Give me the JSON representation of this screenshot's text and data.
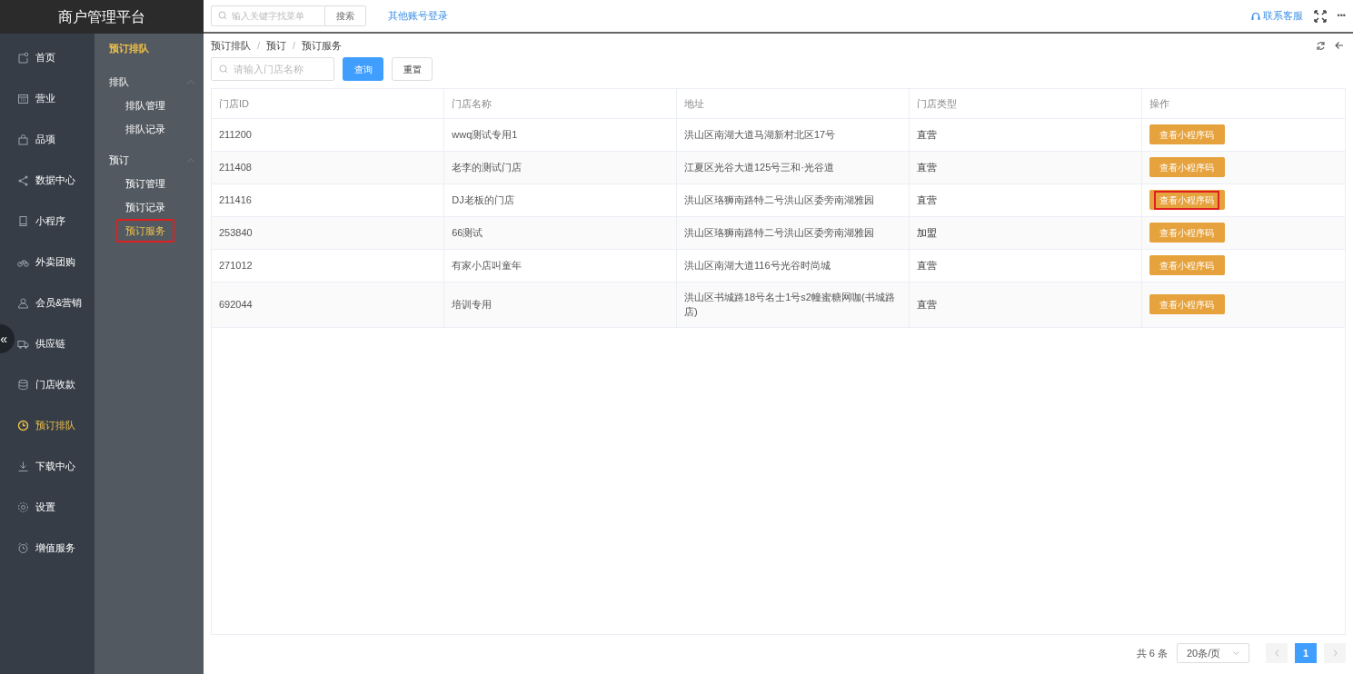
{
  "brand": "商户管理平台",
  "topbar": {
    "search_placeholder": "输入关键字找菜单",
    "search_button": "搜索",
    "switch_account": "其他账号登录",
    "support": "联系客服",
    "more": "•••"
  },
  "nav": [
    {
      "label": "首页",
      "selected": false
    },
    {
      "label": "营业",
      "selected": false
    },
    {
      "label": "品项",
      "selected": false
    },
    {
      "label": "数据中心",
      "selected": false
    },
    {
      "label": "小程序",
      "selected": false
    },
    {
      "label": "外卖团购",
      "selected": false
    },
    {
      "label": "会员&营销",
      "selected": false
    },
    {
      "label": "供应链",
      "selected": false
    },
    {
      "label": "门店收款",
      "selected": false
    },
    {
      "label": "预订排队",
      "selected": true
    },
    {
      "label": "下载中心",
      "selected": false
    },
    {
      "label": "设置",
      "selected": false
    },
    {
      "label": "增值服务",
      "selected": false
    }
  ],
  "collapse_handle": "«",
  "submenu": {
    "title": "预订排队",
    "groups": [
      {
        "label": "排队",
        "expanded": true,
        "children": [
          {
            "label": "排队管理",
            "selected": false,
            "highlighted": false
          },
          {
            "label": "排队记录",
            "selected": false,
            "highlighted": false
          }
        ]
      },
      {
        "label": "预订",
        "expanded": true,
        "children": [
          {
            "label": "预订管理",
            "selected": false,
            "highlighted": false
          },
          {
            "label": "预订记录",
            "selected": false,
            "highlighted": false
          },
          {
            "label": "预订服务",
            "selected": true,
            "highlighted": true
          }
        ]
      }
    ]
  },
  "breadcrumb": [
    "预订排队",
    "预订",
    "预订服务"
  ],
  "breadcrumb_separator": "/",
  "filter": {
    "placeholder": "请输入门店名称",
    "query_button": "查询",
    "reset_button": "重置"
  },
  "table": {
    "columns": [
      "门店ID",
      "门店名称",
      "地址",
      "门店类型",
      "操作"
    ],
    "rows": [
      {
        "id": "211200",
        "name": "wwq测试专用1",
        "address": "洪山区南湖大道马湖新村北区17号",
        "type": "直营",
        "action": "查看小程序码",
        "highlighted": false
      },
      {
        "id": "211408",
        "name": "老李的测试门店",
        "address": "江夏区光谷大道125号三和·光谷道",
        "type": "直营",
        "action": "查看小程序码",
        "highlighted": false
      },
      {
        "id": "211416",
        "name": "DJ老板的门店",
        "address": "洪山区珞狮南路特二号洪山区委旁南湖雅园",
        "type": "直营",
        "action": "查看小程序码",
        "highlighted": true
      },
      {
        "id": "253840",
        "name": "66测试",
        "address": "洪山区珞狮南路特二号洪山区委旁南湖雅园",
        "type": "加盟",
        "action": "查看小程序码",
        "highlighted": false
      },
      {
        "id": "271012",
        "name": "有家小店叫童年",
        "address": "洪山区南湖大道116号光谷时尚城",
        "type": "直营",
        "action": "查看小程序码",
        "highlighted": false
      },
      {
        "id": "692044",
        "name": "培训专用",
        "address": "洪山区书城路18号名士1号s2幢蜜糖网咖(书城路店)",
        "type": "直营",
        "action": "查看小程序码",
        "highlighted": false
      }
    ]
  },
  "pagination": {
    "total": "共 6 条",
    "page_size": "20条/页",
    "pages": [
      {
        "label": "1",
        "selected": true
      }
    ]
  }
}
